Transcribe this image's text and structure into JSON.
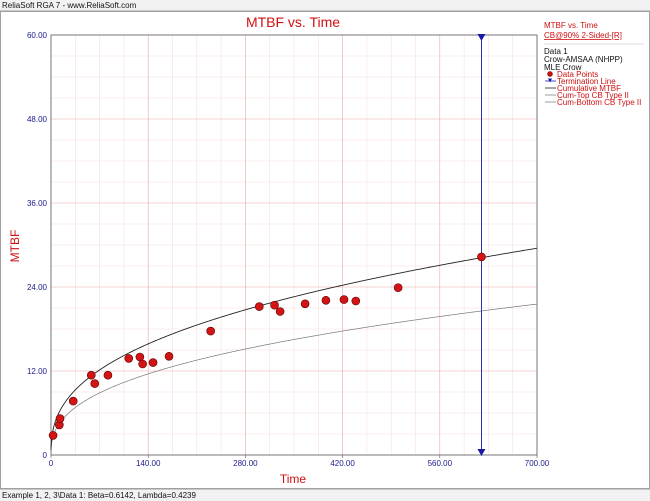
{
  "window": {
    "title": "ReliaSoft RGA 7 - www.ReliaSoft.com",
    "status": "Example 1, 2, 3\\Data 1: Beta=0.6142, Lambda=0.4239"
  },
  "chart_data": {
    "type": "scatter",
    "title": "MTBF vs. Time",
    "xlabel": "Time",
    "ylabel": "MTBF",
    "xlim": [
      0,
      700
    ],
    "ylim": [
      0,
      60
    ],
    "x_ticks": [
      "0",
      "140.00",
      "280.00",
      "420.00",
      "560.00",
      "700.00"
    ],
    "y_ticks": [
      "0",
      "12.00",
      "24.00",
      "36.00",
      "48.00",
      "60.00"
    ],
    "grid": true,
    "model": {
      "beta": 0.6142,
      "lambda": 0.4239
    },
    "termination_time": 620,
    "data_points": [
      {
        "x": 3,
        "y": 2.8
      },
      {
        "x": 12,
        "y": 4.3
      },
      {
        "x": 13,
        "y": 5.2
      },
      {
        "x": 32,
        "y": 7.7
      },
      {
        "x": 58,
        "y": 11.4
      },
      {
        "x": 63,
        "y": 10.2
      },
      {
        "x": 82,
        "y": 11.4
      },
      {
        "x": 112,
        "y": 13.8
      },
      {
        "x": 128,
        "y": 14.0
      },
      {
        "x": 132,
        "y": 13.0
      },
      {
        "x": 147,
        "y": 13.2
      },
      {
        "x": 170,
        "y": 14.1
      },
      {
        "x": 230,
        "y": 17.7
      },
      {
        "x": 300,
        "y": 21.2
      },
      {
        "x": 322,
        "y": 21.4
      },
      {
        "x": 330,
        "y": 20.5
      },
      {
        "x": 366,
        "y": 21.6
      },
      {
        "x": 396,
        "y": 22.1
      },
      {
        "x": 422,
        "y": 22.2
      },
      {
        "x": 439,
        "y": 22.0
      },
      {
        "x": 500,
        "y": 23.9
      },
      {
        "x": 620,
        "y": 28.3
      }
    ],
    "series": [
      {
        "name": "Cumulative MTBF",
        "color": "#222222"
      },
      {
        "name": "Cum-Top CB Type II",
        "color": "#666666"
      },
      {
        "name": "Cum-Bottom CB Type II",
        "color": "#666666"
      }
    ],
    "legend": {
      "placement": "top-right",
      "header": "MTBF vs. Time",
      "header2": "CB@90% 2-Sided-[R]",
      "lines": [
        "Data 1",
        "Crow-AMSAA (NHPP)",
        "MLE Crow"
      ],
      "entries": [
        {
          "label": "Data Points",
          "symbol": "circle",
          "color": "#cc1111"
        },
        {
          "label": "Termination Line",
          "symbol": "triangle",
          "color": "#1a1aa8"
        },
        {
          "label": "Cumulative MTBF",
          "symbol": "line",
          "color": "#222222"
        },
        {
          "label": "Cum-Top CB Type II",
          "symbol": "line",
          "color": "#888888"
        },
        {
          "label": "Cum-Bottom CB Type II",
          "symbol": "line",
          "color": "#888888"
        }
      ]
    }
  }
}
